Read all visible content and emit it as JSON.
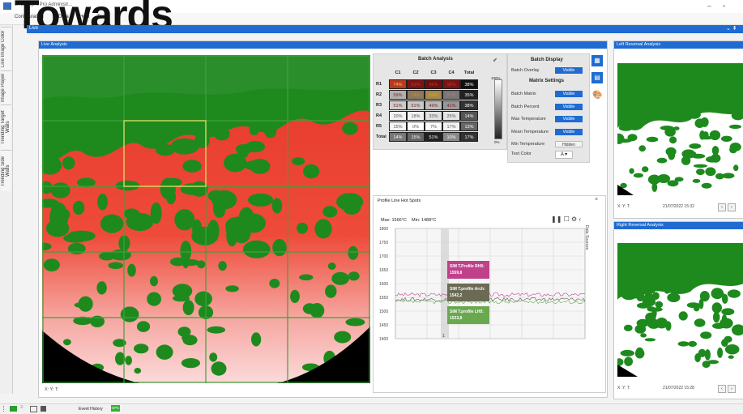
{
  "window": {
    "title": "ETEK Lp... Pro Administr...",
    "minimize": "–",
    "maximize": "▫"
  },
  "overlay_text": "Towards",
  "menu": [
    "Configuration",
    "Data",
    "Help",
    "Tools"
  ],
  "vertical_tabs": [
    "Live Image Color",
    "Image Player",
    "Trending Target Walls",
    "Trending Side Walls"
  ],
  "main_bar": {
    "label": "Live",
    "tools": "⌄ ⇞"
  },
  "live_panel": {
    "title": "Live Analysis",
    "footer": "X:     Y:     T:"
  },
  "batch_analysis": {
    "title": "Batch Analysis",
    "columns": [
      "C1",
      "C2",
      "C3",
      "C4",
      "Total"
    ],
    "rows": [
      {
        "label": "R1",
        "cells": [
          "74%",
          "83%",
          "96%",
          "98%",
          "38%"
        ],
        "colors": [
          "#b83a1f",
          "#7a1414",
          "#6a0f0f",
          "#7a1414",
          "#111111"
        ],
        "text_colors": [
          "#f0c070",
          "#c0392b",
          "#c0392b",
          "#c0392b",
          "#ffffff"
        ]
      },
      {
        "label": "R2",
        "cells": [
          "59%",
          "74%",
          "69%",
          "57%",
          "35%"
        ],
        "colors": [
          "#b0b0b0",
          "#8a7a5a",
          "#a38a4a",
          "#777777",
          "#222222"
        ],
        "text_colors": [
          "#8b1e1e",
          "#d08a2a",
          "#e0a030",
          "#cc7777",
          "#ffffff"
        ]
      },
      {
        "label": "R3",
        "cells": [
          "51%",
          "51%",
          "49%",
          "41%",
          "38%"
        ],
        "colors": [
          "#cccccc",
          "#c8c8c8",
          "#bbbbbb",
          "#999999",
          "#333333"
        ],
        "text_colors": [
          "#7a1e1e",
          "#7a1e1e",
          "#7a1e1e",
          "#7a1e1e",
          "#ffffff"
        ]
      },
      {
        "label": "R4",
        "cells": [
          "20%",
          "18%",
          "33%",
          "25%",
          "14%"
        ],
        "colors": [
          "#f2f2f2",
          "#f2f2f2",
          "#e2e2e2",
          "#e5e5e5",
          "#555555"
        ],
        "text_colors": [
          "#555555",
          "#555555",
          "#555555",
          "#555555",
          "#ffffff"
        ]
      },
      {
        "label": "R5",
        "cells": [
          "15%",
          "0%",
          "7%",
          "17%",
          "13%"
        ],
        "colors": [
          "#f4f4f4",
          "#ffffff",
          "#fafafa",
          "#f3f3f3",
          "#666666"
        ],
        "text_colors": [
          "#555555",
          "#555555",
          "#555555",
          "#555555",
          "#ffffff"
        ]
      },
      {
        "label": "Total",
        "cells": [
          "14%",
          "15%",
          "51%",
          "10%",
          "17%"
        ],
        "colors": [
          "#777777",
          "#666666",
          "#222222",
          "#888888",
          "#333333"
        ],
        "text_colors": [
          "#ffffff",
          "#ffffff",
          "#ffffff",
          "#ffffff",
          "#ffffff"
        ]
      }
    ],
    "gradient_top": "100%",
    "gradient_bottom": "0%"
  },
  "batch_display": {
    "title": "Batch Display",
    "overlay_label": "Batch Overlay",
    "overlay_value": "Visible",
    "matrix_title": "Matrix Settings",
    "settings": [
      {
        "label": "Batch Matrix",
        "value": "Visible",
        "state": "on"
      },
      {
        "label": "Batch Percent",
        "value": "Visible",
        "state": "on"
      },
      {
        "label": "Max Temperature",
        "value": "Visible",
        "state": "on"
      },
      {
        "label": "Mean Temperature",
        "value": "Visible",
        "state": "on"
      },
      {
        "label": "Min Temperature",
        "value": "Hidden",
        "state": "off"
      }
    ],
    "text_color_label": "Text Color",
    "text_color_value": "A ▾"
  },
  "profile": {
    "title": "Profile Line Hot Spots",
    "close": "×",
    "max_label": "Max: 1566°C",
    "min_label": "Min: 1488°C",
    "side_label": "Data Sources",
    "tools": "❚❚ ☐ ⚙  ‹"
  },
  "chart_data": {
    "type": "line",
    "ylim": [
      1400,
      1800
    ],
    "yticks": [
      1800,
      1750,
      1700,
      1650,
      1600,
      1550,
      1500,
      1450,
      1400
    ],
    "series": [
      {
        "name": "SIM T.Profile RH5",
        "color": "#c0408a",
        "value": 1559.8
      },
      {
        "name": "SIM T.profile Arch",
        "color": "#555555",
        "value": 1542.2
      },
      {
        "name": "SIM T.profile LH5",
        "color": "#6aa84f",
        "value": 1533.8
      }
    ],
    "tooltips": [
      {
        "line1": "SIM T.Profile RH5:",
        "line2": "1559,8",
        "color": "#c0408a"
      },
      {
        "line1": "SIM T.profile Arch:",
        "line2": "1542,2",
        "color": "#6b6b55"
      },
      {
        "line1": "SIM T.profile LH5:",
        "line2": "1533,8",
        "color": "#6aa84f"
      }
    ],
    "cursor_label": "1"
  },
  "left_reversal": {
    "title": "Left Reversal Analysis",
    "footer_xy": "X:     Y:     T:",
    "timestamp": "21/07/2022 15:32"
  },
  "right_reversal": {
    "title": "Right Reversal Analysis",
    "footer_xy": "X:     Y:     T:",
    "timestamp": "21/07/2022 15:28"
  },
  "statusbar": {
    "event_history": "Event History",
    "opc": "OPC"
  },
  "colors": {
    "accent": "#1f6bd1",
    "heat_red": "#e83a2a",
    "heat_green": "#1e8a1e"
  }
}
